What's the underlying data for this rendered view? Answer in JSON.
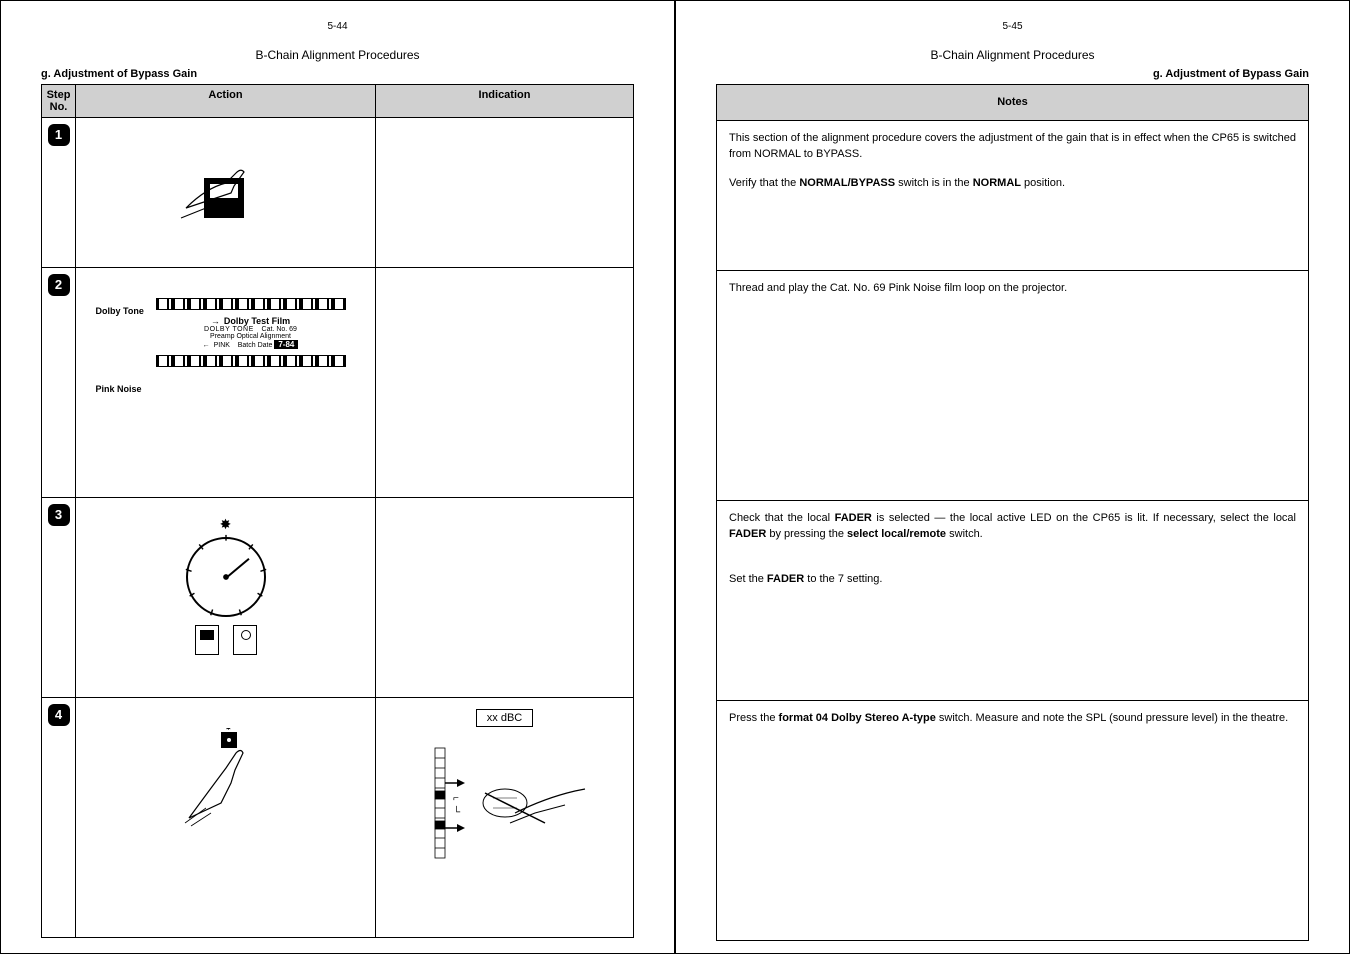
{
  "left": {
    "page_num": "5-44",
    "chain_title": "B-Chain Alignment Procedures",
    "sub": "g.  Adjustment of Bypass Gain",
    "headers": {
      "step": "Step\nNo.",
      "action": "Action",
      "indication": "Indication"
    },
    "steps": {
      "s1": "1",
      "s2": "2",
      "s3": "3",
      "s4": "4"
    },
    "film": {
      "tone_label": "Dolby Tone",
      "pink_label": "Pink Noise",
      "title": "Dolby Test Film",
      "cat": "Cat. No. 69",
      "align": "Preamp Optical Alignment",
      "batch_label": "Batch Date",
      "batch": "7-84",
      "arrow1": "DOLBY TONE",
      "arrow2": "PINK"
    },
    "ind4": "xx dBC"
  },
  "right": {
    "page_num": "5-45",
    "chain_title": "B-Chain Alignment Procedures",
    "sub": "g.  Adjustment of Bypass Gain",
    "header": "Notes",
    "n1a": "This section of the alignment procedure covers the adjustment of the gain that is in effect when the CP65 is switched from NORMAL to BYPASS.",
    "n1b_pre": "Verify that the ",
    "n1b_b1": "NORMAL/BYPASS",
    "n1b_mid": " switch is in the ",
    "n1b_b2": "NORMAL",
    "n1b_post": " position.",
    "n2": "Thread and play the Cat. No. 69 Pink Noise film loop on the projector.",
    "n3a_pre": "Check that the local ",
    "n3a_b1": "FADER",
    "n3a_mid1": " is selected  —  the local active LED on the CP65 is lit.  If necessary, select the local ",
    "n3a_b2": "FADER",
    "n3a_mid2": " by pressing the ",
    "n3a_b3": "select local/remote",
    "n3a_post": " switch.",
    "n3b_pre": "Set the ",
    "n3b_b": "FADER",
    "n3b_post": " to the 7 setting.",
    "n4_pre": "Press the ",
    "n4_b": "format 04 Dolby Stereo A-type",
    "n4_post": " switch.   Measure and note the SPL (sound pressure level) in the theatre."
  }
}
